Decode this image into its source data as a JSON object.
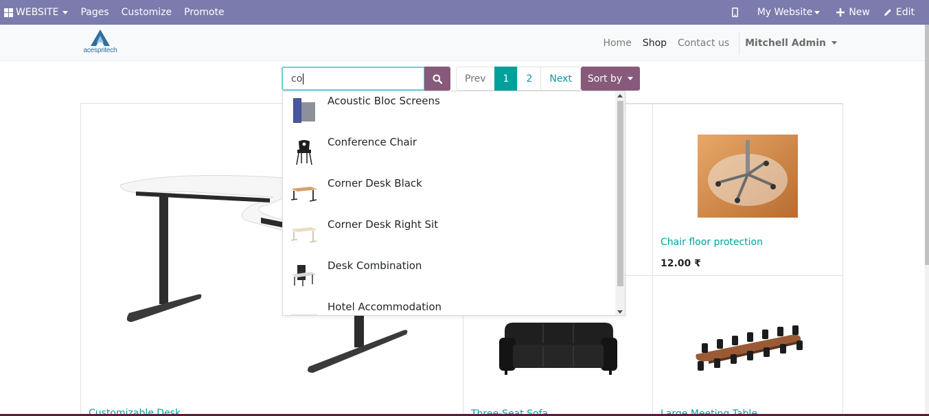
{
  "topbar": {
    "website_label": "WEBSITE",
    "menu": [
      "Pages",
      "Customize",
      "Promote"
    ],
    "my_website_label": "My Website",
    "new_label": "New",
    "edit_label": "Edit",
    "bg_color": "#7c7bad"
  },
  "header": {
    "logo_text": "acespritech",
    "nav": [
      "Home",
      "Shop",
      "Contact us"
    ],
    "active_nav": "Shop",
    "user_label": "Mitchell Admin"
  },
  "search": {
    "value": "co",
    "button_icon": "search-icon"
  },
  "pager": {
    "prev_label": "Prev",
    "pages": [
      "1",
      "2"
    ],
    "current_page": "1",
    "next_label": "Next"
  },
  "sort": {
    "label": "Sort by"
  },
  "autocomplete": {
    "items": [
      {
        "label": "Acoustic Bloc Screens",
        "thumb": "acoustic-screen"
      },
      {
        "label": "Conference Chair",
        "thumb": "chair"
      },
      {
        "label": "Corner Desk Black",
        "thumb": "desk-black"
      },
      {
        "label": "Corner Desk Right Sit",
        "thumb": "desk-light"
      },
      {
        "label": "Desk Combination",
        "thumb": "desk-combo"
      },
      {
        "label": "Hotel Accommodation",
        "thumb": "broken-image"
      }
    ]
  },
  "products": {
    "customizable_desk": {
      "name": "Customizable Desk"
    },
    "chair_floor_protection": {
      "name": "Chair floor protection",
      "price": "12.00 ₹"
    },
    "three_seat_sofa": {
      "name": "Three-Seat Sofa"
    },
    "large_meeting_table": {
      "name": "Large Meeting Table"
    }
  },
  "colors": {
    "primary": "#875a7b",
    "accent": "#00a09d",
    "focus_border": "#67d2d5"
  }
}
